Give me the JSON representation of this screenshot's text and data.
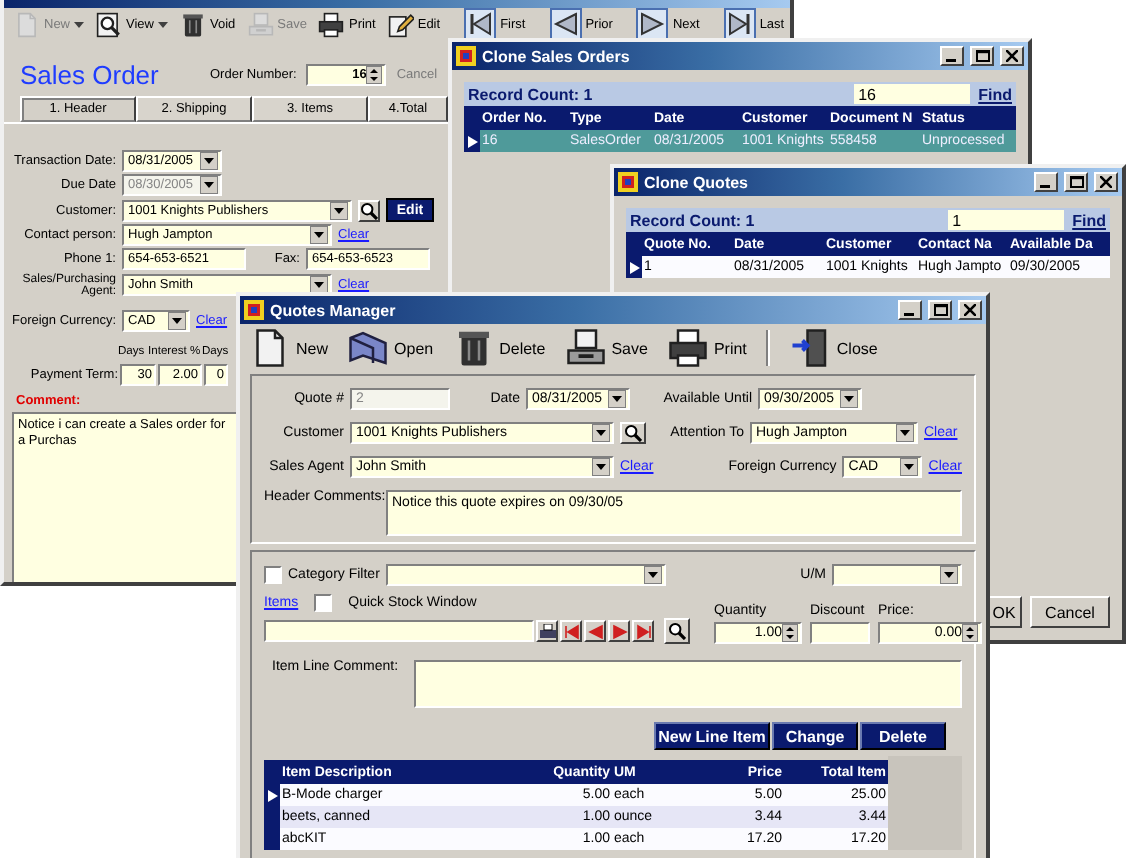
{
  "sales_order": {
    "toolbar": [
      {
        "kind": "new",
        "label": "New",
        "disabled": true,
        "menu": true
      },
      {
        "kind": "view",
        "label": "View",
        "disabled": false,
        "menu": true
      },
      {
        "kind": "void",
        "label": "Void",
        "disabled": false,
        "menu": false
      },
      {
        "kind": "save",
        "label": "Save",
        "disabled": true,
        "menu": false
      },
      {
        "kind": "print",
        "label": "Print",
        "disabled": false,
        "menu": false
      },
      {
        "kind": "edit",
        "label": "Edit",
        "disabled": false,
        "menu": false
      }
    ],
    "nav": [
      {
        "kind": "first",
        "label": "First"
      },
      {
        "kind": "prior",
        "label": "Prior"
      },
      {
        "kind": "next",
        "label": "Next"
      },
      {
        "kind": "last",
        "label": "Last"
      }
    ],
    "heading": "Sales Order",
    "order_number_label": "Order Number:",
    "order_number": "16",
    "cancel": "Cancel",
    "tabs": [
      {
        "label": "1. Header",
        "selected": true
      },
      {
        "label": "2. Shipping",
        "selected": false
      },
      {
        "label": "3. Items",
        "selected": false
      },
      {
        "label": "4.Total",
        "selected": false
      }
    ],
    "transaction_date": {
      "label": "Transaction Date:",
      "value": "08/31/2005",
      "disabled": false
    },
    "due_date": {
      "label": "Due Date",
      "value": "08/30/2005",
      "disabled": true
    },
    "customer": {
      "label": "Customer:",
      "value": "1001 Knights Publishers",
      "edit": "Edit"
    },
    "contact": {
      "label": "Contact person:",
      "value": "Hugh Jampton",
      "clear": "Clear"
    },
    "phone": {
      "label": "Phone 1:",
      "value": "654-653-6521"
    },
    "fax": {
      "label": "Fax:",
      "value": "654-653-6523"
    },
    "agent": {
      "label": "Sales/Purchasing Agent:",
      "value": "John Smith",
      "clear": "Clear"
    },
    "currency": {
      "label": "Foreign Currency:",
      "value": "CAD",
      "clear": "Clear"
    },
    "payment_term": {
      "label": "Payment Term:",
      "columns": [
        "Days",
        "Interest %",
        "Days"
      ],
      "values": [
        "30",
        "2.00",
        "0"
      ]
    },
    "comment": {
      "label": "Comment:",
      "value": "Notice i can create a Sales order for a Purchas"
    }
  },
  "clone_sales_orders": {
    "title": "Clone Sales Orders",
    "record_count": "Record Count: 1",
    "find_value": "16",
    "find": "Find",
    "columns": [
      "Order No.",
      "Type",
      "Date",
      "Customer",
      "Document N",
      "Status"
    ],
    "rows": [
      {
        "current": true,
        "selected": true,
        "cells": [
          "16",
          "SalesOrder",
          "08/31/2005",
          "1001 Knights",
          "558458",
          "Unprocessed"
        ]
      }
    ]
  },
  "clone_quotes": {
    "title": "Clone Quotes",
    "record_count": "Record Count: 1",
    "find_value": "1",
    "find": "Find",
    "columns": [
      "Quote No.",
      "Date",
      "Customer",
      "Contact Na",
      "Available Da"
    ],
    "rows": [
      {
        "current": true,
        "selected": false,
        "cells": [
          "1",
          "08/31/2005",
          "1001 Knights",
          "Hugh Jampto",
          "09/30/2005"
        ]
      }
    ],
    "buttons": [
      "OK",
      "Cancel"
    ]
  },
  "quotes_manager": {
    "title": "Quotes Manager",
    "toolbar": [
      {
        "kind": "new",
        "label": "New"
      },
      {
        "kind": "open",
        "label": "Open"
      },
      {
        "kind": "delete",
        "label": "Delete"
      },
      {
        "kind": "save",
        "label": "Save"
      },
      {
        "kind": "print",
        "label": "Print"
      },
      {
        "kind": "close",
        "label": "Close"
      }
    ],
    "quote_number": {
      "label": "Quote #",
      "value": "2",
      "disabled": true
    },
    "date": {
      "label": "Date",
      "value": "08/31/2005"
    },
    "available_until": {
      "label": "Available Until",
      "value": "09/30/2005"
    },
    "customer": {
      "label": "Customer",
      "value": "1001 Knights Publishers"
    },
    "attention_to": {
      "label": "Attention To",
      "value": "Hugh Jampton",
      "clear": "Clear"
    },
    "sales_agent": {
      "label": "Sales Agent",
      "value": "John Smith",
      "clear": "Clear"
    },
    "foreign_currency": {
      "label": "Foreign Currency",
      "value": "CAD",
      "clear": "Clear"
    },
    "header_comments": {
      "label": "Header Comments:",
      "value": "Notice this quote expires on 09/30/05"
    },
    "category_filter": {
      "label": "Category Filter",
      "checked": false
    },
    "um": {
      "label": "U/M"
    },
    "items": {
      "label": "Items"
    },
    "quick_stock": {
      "label": "Quick Stock Window",
      "checked": false
    },
    "quantity": {
      "label": "Quantity",
      "value": "1.00"
    },
    "discount": {
      "label": "Discount"
    },
    "price": {
      "label": "Price:",
      "value": "0.00"
    },
    "item_line_comment": {
      "label": "Item Line Comment:"
    },
    "actions": [
      "New Line Item",
      "Change",
      "Delete"
    ],
    "grid": {
      "columns": [
        "Item Description",
        "Quantity",
        "UM",
        "Price",
        "Total Item"
      ],
      "rows": [
        {
          "current": true,
          "cells": [
            "B-Mode charger",
            "5.00",
            "each",
            "5.00",
            "25.00"
          ]
        },
        {
          "current": false,
          "cells": [
            "beets, canned",
            "1.00",
            "ounce",
            "3.44",
            "3.44"
          ]
        },
        {
          "current": false,
          "cells": [
            "abcKIT",
            "1.00",
            "each",
            "17.20",
            "17.20"
          ]
        }
      ]
    }
  }
}
